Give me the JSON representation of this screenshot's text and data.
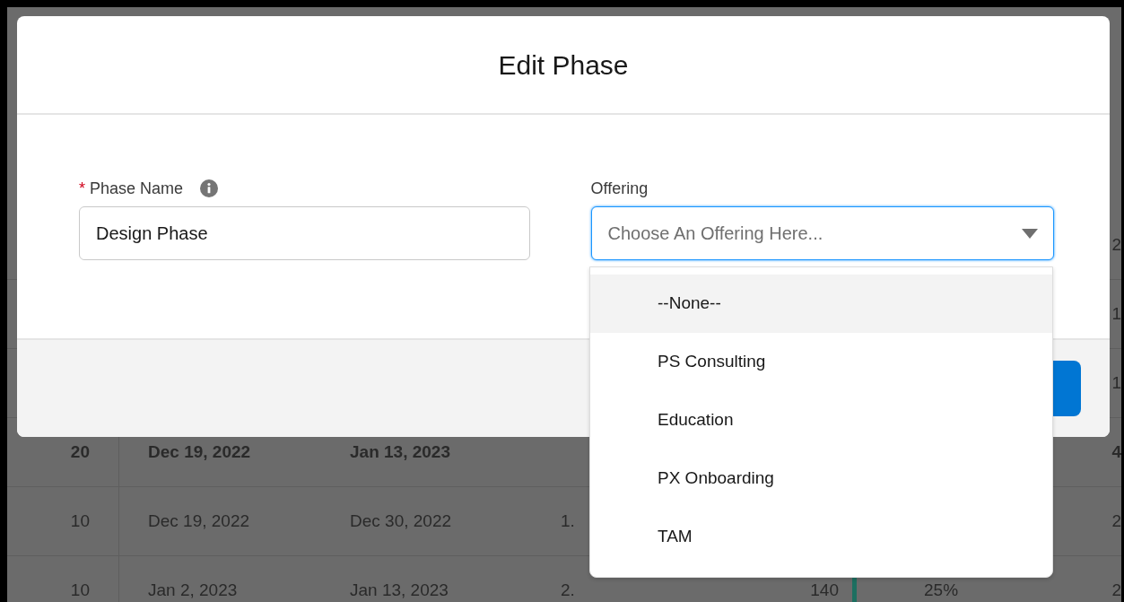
{
  "modal": {
    "title": "Edit Phase",
    "fields": [
      {
        "kind": "text",
        "required_mark": "*",
        "label": "Phase Name",
        "info": true,
        "value": "Design Phase"
      },
      {
        "kind": "select",
        "label": "Offering",
        "placeholder": "Choose An Offering Here...",
        "focused": true
      }
    ],
    "dropdown": {
      "options": [
        {
          "label": "--None--",
          "selected": true
        },
        {
          "label": "PS Consulting",
          "selected": false
        },
        {
          "label": "Education",
          "selected": false
        },
        {
          "label": "PX Onboarding",
          "selected": false
        },
        {
          "label": "TAM",
          "selected": false
        }
      ]
    }
  },
  "background_table": {
    "rows": [
      {
        "bold": false,
        "marker": false,
        "column_7": "2"
      },
      {
        "bold": false,
        "marker": false,
        "column_7": "1"
      },
      {
        "bold": false,
        "marker": false,
        "column_7": "1"
      },
      {
        "bold": true,
        "marker": false,
        "column_1": "20",
        "column_2": "Dec 19, 2022",
        "column_3": "Jan 13, 2023",
        "column_7": "4"
      },
      {
        "bold": false,
        "marker": false,
        "column_1": "10",
        "column_2": "Dec 19, 2022",
        "column_3": "Dec 30, 2022",
        "column_4": "1.",
        "column_7": "2"
      },
      {
        "bold": false,
        "marker": true,
        "column_1": "10",
        "column_2": "Jan 2, 2023",
        "column_3": "Jan 13, 2023",
        "column_4": "2.",
        "column_5": "140",
        "column_6": "25%",
        "column_7": "2"
      }
    ]
  }
}
